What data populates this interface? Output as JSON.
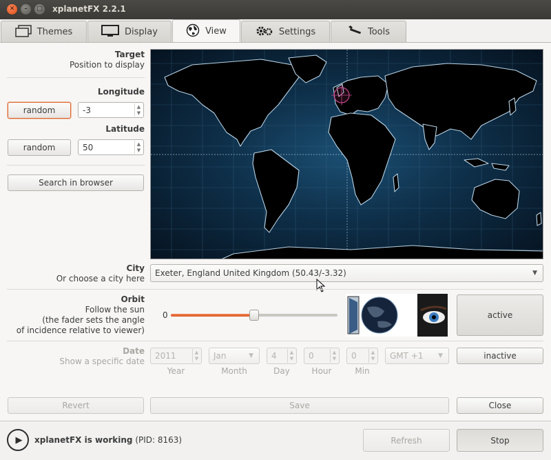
{
  "window": {
    "title": "xplanetFX 2.2.1"
  },
  "tabs": [
    {
      "label": "Themes",
      "icon": "windows-icon"
    },
    {
      "label": "Display",
      "icon": "monitor-icon"
    },
    {
      "label": "View",
      "icon": "globe-icon"
    },
    {
      "label": "Settings",
      "icon": "gears-icon"
    },
    {
      "label": "Tools",
      "icon": "wrench-icon"
    }
  ],
  "target": {
    "title": "Target",
    "subtitle": "Position to display"
  },
  "longitude": {
    "label": "Longitude",
    "random_label": "random",
    "value": "-3"
  },
  "latitude": {
    "label": "Latitude",
    "random_label": "random",
    "value": "50"
  },
  "search_browser_label": "Search in browser",
  "city": {
    "title": "City",
    "subtitle": "Or choose a city here",
    "selected": "Exeter,  England United Kingdom (50.43/-3.32)"
  },
  "orbit": {
    "title": "Orbit",
    "line1": "Follow the sun",
    "line2": "(the fader sets the angle",
    "line3": "of incidence relative to viewer)",
    "slider_min_label": "0",
    "slider_level": 0.5,
    "button_label": "active"
  },
  "date": {
    "title": "Date",
    "subtitle": "Show a specific date",
    "year": "2011",
    "month": "Jan",
    "day": "4",
    "hour": "0",
    "min": "0",
    "timezone": "GMT +1",
    "button_label": "inactive",
    "labels": {
      "year": "Year",
      "month": "Month",
      "day": "Day",
      "hour": "Hour",
      "min": "Min"
    }
  },
  "actions": {
    "revert": "Revert",
    "save": "Save",
    "close": "Close"
  },
  "status": {
    "app_name": "xplanetFX is working",
    "pid_text": "(PID: 8163)",
    "refresh": "Refresh",
    "stop": "Stop"
  },
  "colors": {
    "accent": "#e0642b",
    "titlebar": "#3c3b37",
    "map_ocean": "#0e2f49"
  }
}
